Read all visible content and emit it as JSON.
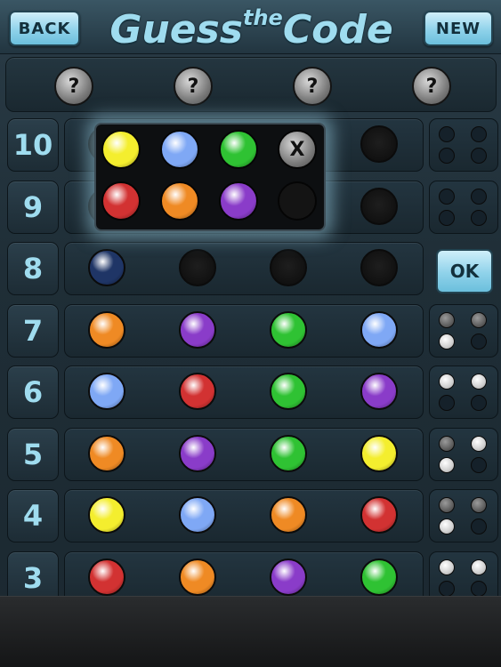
{
  "header": {
    "back_label": "BACK",
    "new_label": "NEW",
    "title_a": "Guess",
    "title_the": "the",
    "title_b": "Code"
  },
  "secret": {
    "hidden_symbol": "?"
  },
  "ok_label": "OK",
  "colors": {
    "yellow": "#f4ee2e",
    "blue": "#7fa8f5",
    "green": "#2fc233",
    "red": "#d23232",
    "orange": "#ef8a24",
    "purple": "#8a3cc9",
    "navy": "#1f3566"
  },
  "picker": {
    "colors": [
      "yellow",
      "blue",
      "green",
      "red",
      "orange",
      "purple"
    ],
    "clear_symbol": "X"
  },
  "rows": [
    {
      "num": "10",
      "pegs": [
        "empty",
        "empty",
        "empty",
        "empty"
      ],
      "feedback": [
        "empty",
        "empty",
        "empty",
        "empty"
      ]
    },
    {
      "num": "9",
      "pegs": [
        "empty",
        "empty",
        "empty",
        "empty"
      ],
      "feedback": [
        "empty",
        "empty",
        "empty",
        "empty"
      ]
    },
    {
      "num": "8",
      "pegs": [
        "navy",
        "empty",
        "empty",
        "empty"
      ],
      "feedback": null
    },
    {
      "num": "7",
      "pegs": [
        "orange",
        "purple",
        "green",
        "blue"
      ],
      "feedback": [
        "gray",
        "gray",
        "white",
        "empty"
      ]
    },
    {
      "num": "6",
      "pegs": [
        "blue",
        "red",
        "green",
        "purple"
      ],
      "feedback": [
        "white",
        "white",
        "empty",
        "empty"
      ]
    },
    {
      "num": "5",
      "pegs": [
        "orange",
        "purple",
        "green",
        "yellow"
      ],
      "feedback": [
        "gray",
        "white",
        "white",
        "empty"
      ]
    },
    {
      "num": "4",
      "pegs": [
        "yellow",
        "blue",
        "orange",
        "red"
      ],
      "feedback": [
        "gray",
        "gray",
        "white",
        "empty"
      ]
    },
    {
      "num": "3",
      "pegs": [
        "red",
        "orange",
        "purple",
        "green"
      ],
      "feedback": [
        "white",
        "white",
        "empty",
        "empty"
      ]
    }
  ]
}
